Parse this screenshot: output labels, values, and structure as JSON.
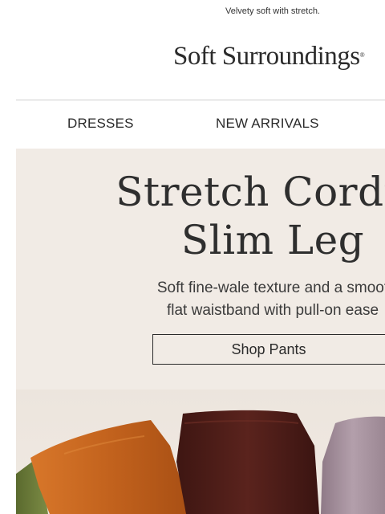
{
  "preheader": {
    "text": "Velvety soft with stretch."
  },
  "brand": {
    "name": "Soft Surroundings",
    "trademark": "®"
  },
  "nav": {
    "items": [
      {
        "label": "DRESSES"
      },
      {
        "label": "NEW ARRIVALS"
      }
    ]
  },
  "hero": {
    "title_line1": "Stretch Cordur",
    "title_line2": "Slim Leg",
    "copy_line1": "Soft fine-wale texture and a smoot",
    "copy_line2": "flat waistband with pull-on ease",
    "cta_label": "Shop Pants",
    "background": "#f1ebe5",
    "pant_colors": [
      "#6b7a3a",
      "#c2621d",
      "#4a1c18",
      "#a38c98"
    ]
  }
}
